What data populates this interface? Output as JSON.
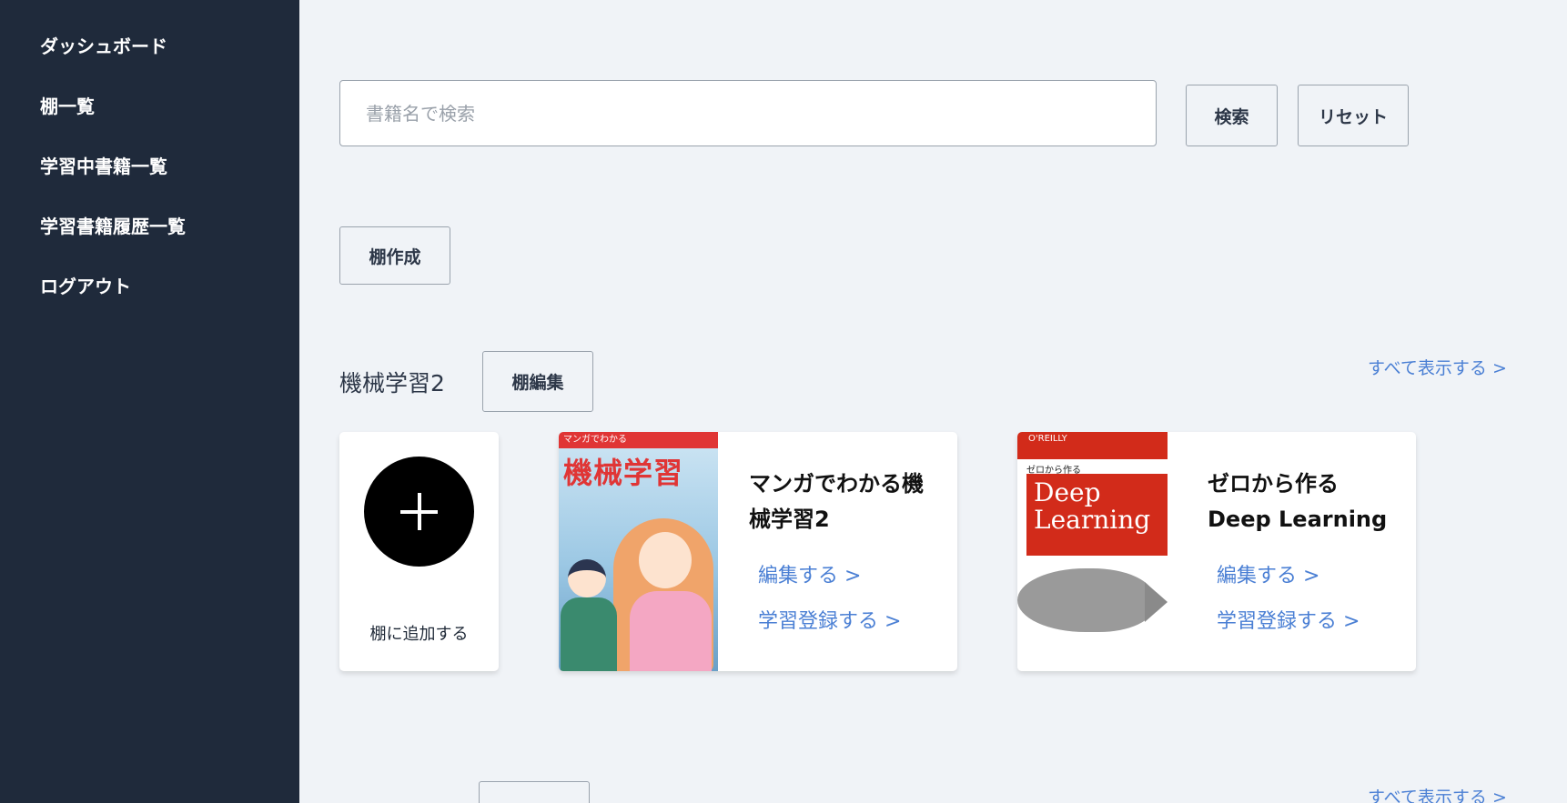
{
  "sidebar": {
    "items": [
      {
        "label": "ダッシュボード"
      },
      {
        "label": "棚一覧"
      },
      {
        "label": "学習中書籍一覧"
      },
      {
        "label": "学習書籍履歴一覧"
      },
      {
        "label": "ログアウト"
      }
    ]
  },
  "search": {
    "placeholder": "書籍名で検索",
    "value": "",
    "search_label": "検索",
    "reset_label": "リセット"
  },
  "create_shelf_label": "棚作成",
  "shelves": [
    {
      "name": "機械学習2",
      "edit_label": "棚編集",
      "view_all_label": "すべて表示する >",
      "add_card_label": "棚に追加する",
      "books": [
        {
          "title": "マンガでわかる機械学習2",
          "edit_link": "編集する >",
          "study_link": "学習登録する >",
          "cover_top": "マンガでわかる",
          "cover_title": "機械学習"
        },
        {
          "title": "ゼロから作る Deep Learning",
          "edit_link": "編集する >",
          "study_link": "学習登録する >",
          "cover_brand": "O'REILLY",
          "cover_sub": "ゼロから作る",
          "cover_title": "Deep Learning"
        }
      ]
    },
    {
      "name": "",
      "edit_label": "",
      "view_all_label": "すべて表示する >"
    }
  ],
  "colors": {
    "sidebar_bg": "#1f2a3b",
    "page_bg": "#f0f3f7",
    "link": "#4a7fd4"
  },
  "icons": {
    "add": "plus-icon"
  }
}
